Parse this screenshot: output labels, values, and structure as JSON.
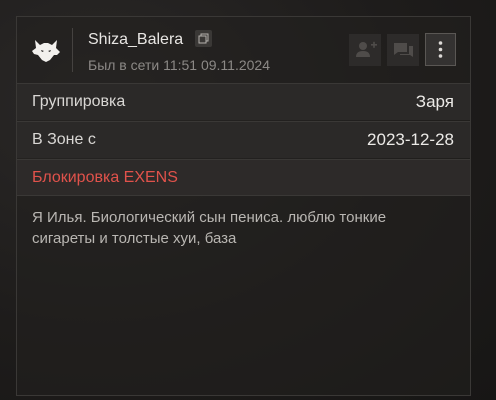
{
  "profile": {
    "username": "Shiza_Balera",
    "last_seen": "Был в сети 11:51 09.11.2024"
  },
  "info": {
    "group_label": "Группировка",
    "group_value": "Заря",
    "zone_label": "В Зоне с",
    "zone_value": "2023-12-28",
    "block_label": "Блокировка EXENS"
  },
  "bio": "Я Илья. Биологический сын пениса. люблю тонкие сигареты и толстые хуи, база",
  "icons": {
    "logo": "wolf-logo-icon",
    "copy": "copy-icon",
    "add_friend": "add-friend-icon",
    "message": "message-icon",
    "menu": "more-vertical-icon"
  },
  "colors": {
    "accent_red": "#e0524b",
    "background": "#1f1d1c"
  }
}
